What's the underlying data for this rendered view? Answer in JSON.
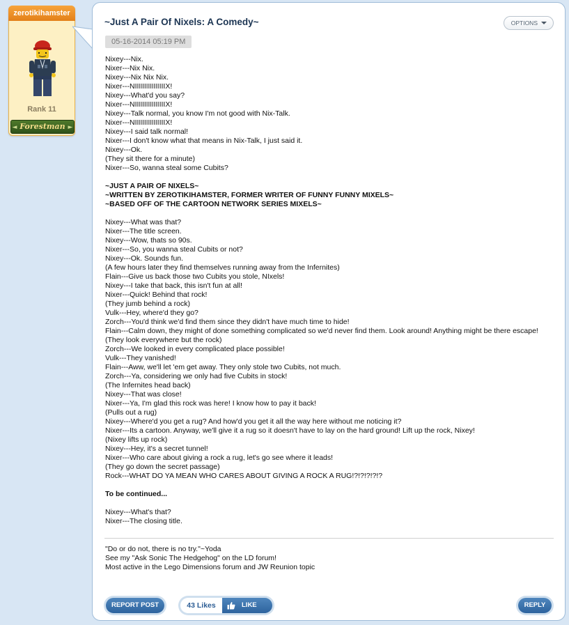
{
  "author": {
    "username": "zerotikihamster",
    "rank": "Rank 11",
    "badge": "Forestman"
  },
  "post": {
    "title": "~Just A Pair Of Nixels: A Comedy~",
    "options_label": "OPTIONS",
    "date": "05-16-2014 05:19 PM",
    "lines": [
      {
        "text": "Nixey---Nix."
      },
      {
        "text": "Nixer---Nix Nix."
      },
      {
        "text": "Nixey---Nix Nix Nix."
      },
      {
        "text": "Nixer---NIIIIIIIIIIIIIIIX!"
      },
      {
        "text": "Nixey---What'd you say?"
      },
      {
        "text": "Nixer---NIIIIIIIIIIIIIIIX!"
      },
      {
        "text": "Nixey---Talk normal, you know I'm not good with Nix-Talk."
      },
      {
        "text": "Nixer---NIIIIIIIIIIIIIIIX!"
      },
      {
        "text": "Nixey---I said talk normal!"
      },
      {
        "text": "Nixer---I don't know what that means in Nix-Talk, I just said it."
      },
      {
        "text": "Nixey---Ok."
      },
      {
        "text": "(They sit there for a minute)"
      },
      {
        "text": "Nixer---So, wanna steal some Cubits?"
      },
      {
        "text": ""
      },
      {
        "text": "~JUST A PAIR OF NIXELS~",
        "bold": true
      },
      {
        "text": "~WRITTEN BY ZEROTIKIHAMSTER, FORMER WRITER OF FUNNY FUNNY MIXELS~",
        "bold": true
      },
      {
        "text": "~BASED OFF OF THE CARTOON NETWORK SERIES MIXELS~",
        "bold": true
      },
      {
        "text": ""
      },
      {
        "text": "Nixey---What was that?"
      },
      {
        "text": "Nixer---The title screen."
      },
      {
        "text": "Nixey---Wow, thats so 90s."
      },
      {
        "text": "Nixer---So, you wanna steal Cubits or not?"
      },
      {
        "text": "Nixey---Ok. Sounds fun."
      },
      {
        "text": "(A few hours later they find themselves running away from the Infernites)"
      },
      {
        "text": "Flain---Give us back those two Cubits you stole, NIxels!"
      },
      {
        "text": "Nixey---I take that back, this isn't fun at all!"
      },
      {
        "text": "Nixer---Quick! Behind that rock!"
      },
      {
        "text": "(They jumb behind a rock)"
      },
      {
        "text": "Vulk---Hey, where'd they go?"
      },
      {
        "text": "Zorch---You'd think we'd find them since they didn't have much time to hide!"
      },
      {
        "text": "Flain---Calm down, they might of done something complicated so we'd never find them. Look around! Anything might be there escape!"
      },
      {
        "text": "(They look everywhere but the rock)"
      },
      {
        "text": "Zorch---We looked in every complicated place possible!"
      },
      {
        "text": "Vulk---They vanished!"
      },
      {
        "text": "Flain---Aww, we'll let 'em get away. They only stole two Cubits, not much."
      },
      {
        "text": "Zorch---Ya, considering we only had five Cubits in stock!"
      },
      {
        "text": "(The Infernites head back)"
      },
      {
        "text": "Nixey---That was close!"
      },
      {
        "text": "Nixer---Ya, I'm glad this rock was here! I know how to pay it back!"
      },
      {
        "text": "(Pulls out a rug)"
      },
      {
        "text": "Nixey---Where'd you get a rug? And how'd you get it all the way here without me noticing it?"
      },
      {
        "text": "Nixer---Its a cartoon. Anyway, we'll give it a rug so it doesn't have to lay on the hard ground! Lift up the rock, Nixey!"
      },
      {
        "text": "(Nixey lifts up rock)"
      },
      {
        "text": "Nixey---Hey, it's a secret tunnel!"
      },
      {
        "text": "Nixer---Who care about giving a rock a rug, let's go see where it leads!"
      },
      {
        "text": "(They go down the secret passage)"
      },
      {
        "text": "Rock---WHAT DO YA MEAN WHO CARES ABOUT GIVING A ROCK A RUG!?!?!?!?!?"
      },
      {
        "text": ""
      },
      {
        "text": "To be continued...",
        "bold": true
      },
      {
        "text": ""
      },
      {
        "text": "Nixey---What's that?"
      },
      {
        "text": "Nixer---The closing title."
      }
    ],
    "signature": [
      "\"Do or do not, there is no try.\"~Yoda",
      "See my \"Ask Sonic The Hedgehog\" on the LD forum!",
      "Most active in the Lego Dimensions forum and JW Reunion topic"
    ]
  },
  "actions": {
    "report_label": "REPORT POST",
    "likes_count": "43 Likes",
    "like_label": "LIKE",
    "reply_label": "REPLY"
  }
}
